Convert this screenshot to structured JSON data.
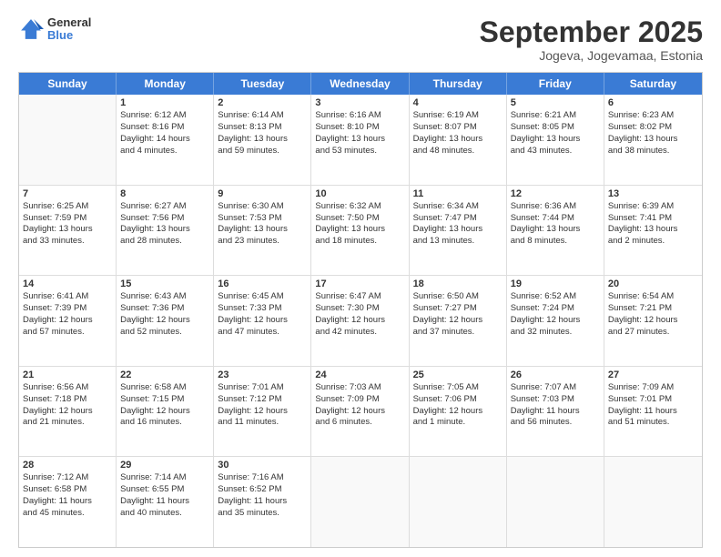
{
  "header": {
    "logo": {
      "line1": "General",
      "line2": "Blue"
    },
    "title": "September 2025",
    "subtitle": "Jogeva, Jogevamaa, Estonia"
  },
  "calendar": {
    "days": [
      "Sunday",
      "Monday",
      "Tuesday",
      "Wednesday",
      "Thursday",
      "Friday",
      "Saturday"
    ],
    "rows": [
      [
        {
          "day": "",
          "empty": true
        },
        {
          "day": "1",
          "lines": [
            "Sunrise: 6:12 AM",
            "Sunset: 8:16 PM",
            "Daylight: 14 hours",
            "and 4 minutes."
          ]
        },
        {
          "day": "2",
          "lines": [
            "Sunrise: 6:14 AM",
            "Sunset: 8:13 PM",
            "Daylight: 13 hours",
            "and 59 minutes."
          ]
        },
        {
          "day": "3",
          "lines": [
            "Sunrise: 6:16 AM",
            "Sunset: 8:10 PM",
            "Daylight: 13 hours",
            "and 53 minutes."
          ]
        },
        {
          "day": "4",
          "lines": [
            "Sunrise: 6:19 AM",
            "Sunset: 8:07 PM",
            "Daylight: 13 hours",
            "and 48 minutes."
          ]
        },
        {
          "day": "5",
          "lines": [
            "Sunrise: 6:21 AM",
            "Sunset: 8:05 PM",
            "Daylight: 13 hours",
            "and 43 minutes."
          ]
        },
        {
          "day": "6",
          "lines": [
            "Sunrise: 6:23 AM",
            "Sunset: 8:02 PM",
            "Daylight: 13 hours",
            "and 38 minutes."
          ]
        }
      ],
      [
        {
          "day": "7",
          "lines": [
            "Sunrise: 6:25 AM",
            "Sunset: 7:59 PM",
            "Daylight: 13 hours",
            "and 33 minutes."
          ]
        },
        {
          "day": "8",
          "lines": [
            "Sunrise: 6:27 AM",
            "Sunset: 7:56 PM",
            "Daylight: 13 hours",
            "and 28 minutes."
          ]
        },
        {
          "day": "9",
          "lines": [
            "Sunrise: 6:30 AM",
            "Sunset: 7:53 PM",
            "Daylight: 13 hours",
            "and 23 minutes."
          ]
        },
        {
          "day": "10",
          "lines": [
            "Sunrise: 6:32 AM",
            "Sunset: 7:50 PM",
            "Daylight: 13 hours",
            "and 18 minutes."
          ]
        },
        {
          "day": "11",
          "lines": [
            "Sunrise: 6:34 AM",
            "Sunset: 7:47 PM",
            "Daylight: 13 hours",
            "and 13 minutes."
          ]
        },
        {
          "day": "12",
          "lines": [
            "Sunrise: 6:36 AM",
            "Sunset: 7:44 PM",
            "Daylight: 13 hours",
            "and 8 minutes."
          ]
        },
        {
          "day": "13",
          "lines": [
            "Sunrise: 6:39 AM",
            "Sunset: 7:41 PM",
            "Daylight: 13 hours",
            "and 2 minutes."
          ]
        }
      ],
      [
        {
          "day": "14",
          "lines": [
            "Sunrise: 6:41 AM",
            "Sunset: 7:39 PM",
            "Daylight: 12 hours",
            "and 57 minutes."
          ]
        },
        {
          "day": "15",
          "lines": [
            "Sunrise: 6:43 AM",
            "Sunset: 7:36 PM",
            "Daylight: 12 hours",
            "and 52 minutes."
          ]
        },
        {
          "day": "16",
          "lines": [
            "Sunrise: 6:45 AM",
            "Sunset: 7:33 PM",
            "Daylight: 12 hours",
            "and 47 minutes."
          ]
        },
        {
          "day": "17",
          "lines": [
            "Sunrise: 6:47 AM",
            "Sunset: 7:30 PM",
            "Daylight: 12 hours",
            "and 42 minutes."
          ]
        },
        {
          "day": "18",
          "lines": [
            "Sunrise: 6:50 AM",
            "Sunset: 7:27 PM",
            "Daylight: 12 hours",
            "and 37 minutes."
          ]
        },
        {
          "day": "19",
          "lines": [
            "Sunrise: 6:52 AM",
            "Sunset: 7:24 PM",
            "Daylight: 12 hours",
            "and 32 minutes."
          ]
        },
        {
          "day": "20",
          "lines": [
            "Sunrise: 6:54 AM",
            "Sunset: 7:21 PM",
            "Daylight: 12 hours",
            "and 27 minutes."
          ]
        }
      ],
      [
        {
          "day": "21",
          "lines": [
            "Sunrise: 6:56 AM",
            "Sunset: 7:18 PM",
            "Daylight: 12 hours",
            "and 21 minutes."
          ]
        },
        {
          "day": "22",
          "lines": [
            "Sunrise: 6:58 AM",
            "Sunset: 7:15 PM",
            "Daylight: 12 hours",
            "and 16 minutes."
          ]
        },
        {
          "day": "23",
          "lines": [
            "Sunrise: 7:01 AM",
            "Sunset: 7:12 PM",
            "Daylight: 12 hours",
            "and 11 minutes."
          ]
        },
        {
          "day": "24",
          "lines": [
            "Sunrise: 7:03 AM",
            "Sunset: 7:09 PM",
            "Daylight: 12 hours",
            "and 6 minutes."
          ]
        },
        {
          "day": "25",
          "lines": [
            "Sunrise: 7:05 AM",
            "Sunset: 7:06 PM",
            "Daylight: 12 hours",
            "and 1 minute."
          ]
        },
        {
          "day": "26",
          "lines": [
            "Sunrise: 7:07 AM",
            "Sunset: 7:03 PM",
            "Daylight: 11 hours",
            "and 56 minutes."
          ]
        },
        {
          "day": "27",
          "lines": [
            "Sunrise: 7:09 AM",
            "Sunset: 7:01 PM",
            "Daylight: 11 hours",
            "and 51 minutes."
          ]
        }
      ],
      [
        {
          "day": "28",
          "lines": [
            "Sunrise: 7:12 AM",
            "Sunset: 6:58 PM",
            "Daylight: 11 hours",
            "and 45 minutes."
          ]
        },
        {
          "day": "29",
          "lines": [
            "Sunrise: 7:14 AM",
            "Sunset: 6:55 PM",
            "Daylight: 11 hours",
            "and 40 minutes."
          ]
        },
        {
          "day": "30",
          "lines": [
            "Sunrise: 7:16 AM",
            "Sunset: 6:52 PM",
            "Daylight: 11 hours",
            "and 35 minutes."
          ]
        },
        {
          "day": "",
          "empty": true
        },
        {
          "day": "",
          "empty": true
        },
        {
          "day": "",
          "empty": true
        },
        {
          "day": "",
          "empty": true
        }
      ]
    ]
  }
}
